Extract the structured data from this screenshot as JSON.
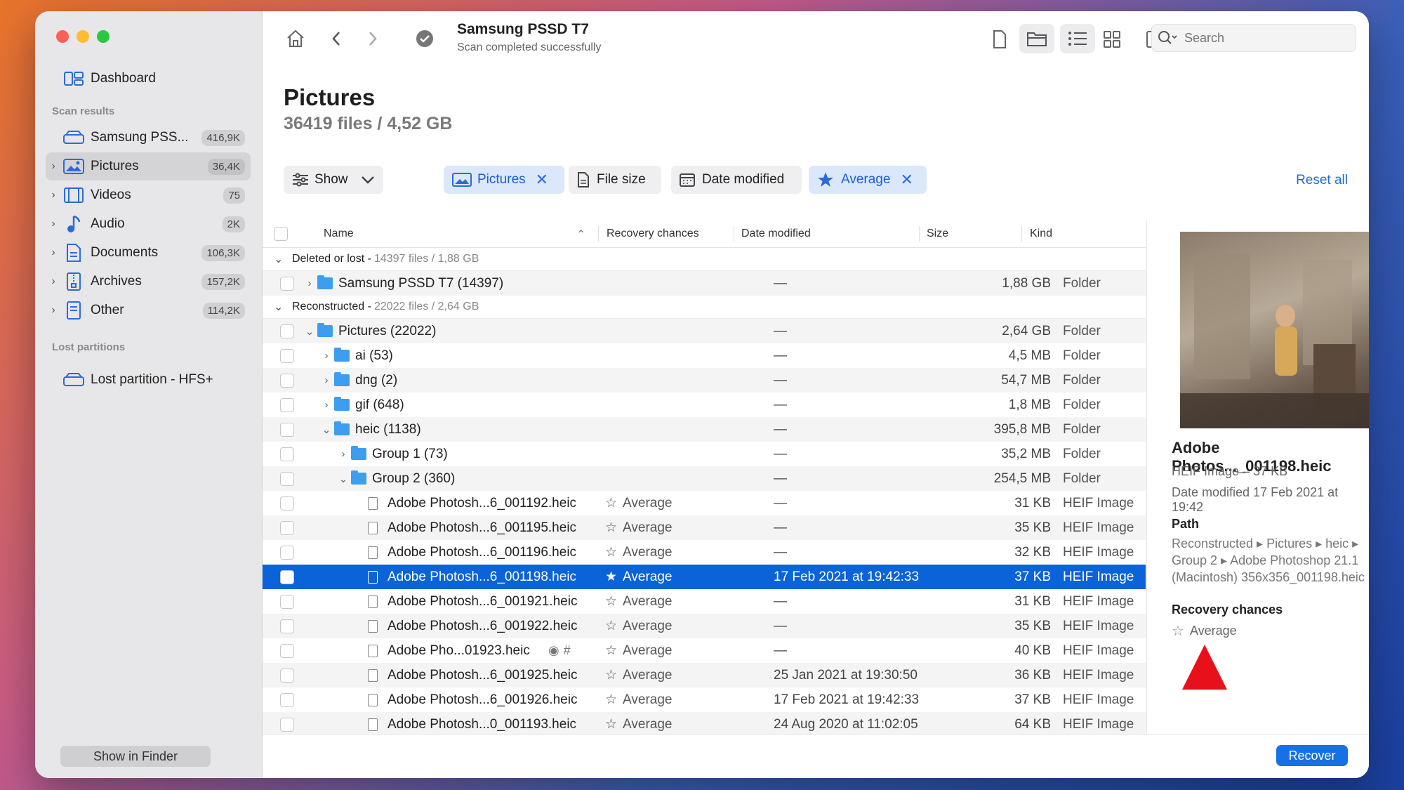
{
  "sidebar": {
    "dashboard": "Dashboard",
    "scan_results_title": "Scan results",
    "items": [
      {
        "label": "Samsung PSS...",
        "badge": "416,9K"
      },
      {
        "label": "Pictures",
        "badge": "36,4K"
      },
      {
        "label": "Videos",
        "badge": "75"
      },
      {
        "label": "Audio",
        "badge": "2K"
      },
      {
        "label": "Documents",
        "badge": "106,3K"
      },
      {
        "label": "Archives",
        "badge": "157,2K"
      },
      {
        "label": "Other",
        "badge": "114,2K"
      }
    ],
    "lost_partitions_title": "Lost partitions",
    "lost_partition": "Lost partition - HFS+",
    "show_in_finder": "Show in Finder"
  },
  "toolbar": {
    "title": "Samsung PSSD T7",
    "subtitle": "Scan completed successfully",
    "search_placeholder": "Search"
  },
  "page": {
    "title": "Pictures",
    "summary": "36419 files / 4,52 GB"
  },
  "filters": {
    "show": "Show",
    "pictures": "Pictures",
    "file_size": "File size",
    "date_modified": "Date modified",
    "average": "Average",
    "reset_all": "Reset all"
  },
  "table": {
    "headers": {
      "name": "Name",
      "recovery": "Recovery chances",
      "date": "Date modified",
      "size": "Size",
      "kind": "Kind"
    },
    "group1": {
      "label": "Deleted or lost -",
      "count": "14397 files / 1,88 GB"
    },
    "group2": {
      "label": "Reconstructed -",
      "count": "22022 files / 2,64 GB"
    },
    "rows": [
      {
        "name": "Samsung PSSD T7 (14397)",
        "rec": "",
        "date": "—",
        "size": "1,88 GB",
        "kind": "Folder"
      },
      {
        "name": "Pictures (22022)",
        "rec": "",
        "date": "—",
        "size": "2,64 GB",
        "kind": "Folder"
      },
      {
        "name": "ai (53)",
        "rec": "",
        "date": "—",
        "size": "4,5 MB",
        "kind": "Folder"
      },
      {
        "name": "dng (2)",
        "rec": "",
        "date": "—",
        "size": "54,7 MB",
        "kind": "Folder"
      },
      {
        "name": "gif (648)",
        "rec": "",
        "date": "—",
        "size": "1,8 MB",
        "kind": "Folder"
      },
      {
        "name": "heic (1138)",
        "rec": "",
        "date": "—",
        "size": "395,8 MB",
        "kind": "Folder"
      },
      {
        "name": "Group 1 (73)",
        "rec": "",
        "date": "—",
        "size": "35,2 MB",
        "kind": "Folder"
      },
      {
        "name": "Group 2 (360)",
        "rec": "",
        "date": "—",
        "size": "254,5 MB",
        "kind": "Folder"
      },
      {
        "name": "Adobe Photosh...6_001192.heic",
        "rec": "Average",
        "date": "—",
        "size": "31 KB",
        "kind": "HEIF Image"
      },
      {
        "name": "Adobe Photosh...6_001195.heic",
        "rec": "Average",
        "date": "—",
        "size": "35 KB",
        "kind": "HEIF Image"
      },
      {
        "name": "Adobe Photosh...6_001196.heic",
        "rec": "Average",
        "date": "—",
        "size": "32 KB",
        "kind": "HEIF Image"
      },
      {
        "name": "Adobe Photosh...6_001198.heic",
        "rec": "Average",
        "date": "17 Feb 2021 at 19:42:33",
        "size": "37 KB",
        "kind": "HEIF Image"
      },
      {
        "name": "Adobe Photosh...6_001921.heic",
        "rec": "Average",
        "date": "—",
        "size": "31 KB",
        "kind": "HEIF Image"
      },
      {
        "name": "Adobe Photosh...6_001922.heic",
        "rec": "Average",
        "date": "—",
        "size": "35 KB",
        "kind": "HEIF Image"
      },
      {
        "name": "Adobe Pho...01923.heic",
        "rec": "Average",
        "date": "—",
        "size": "40 KB",
        "kind": "HEIF Image"
      },
      {
        "name": "Adobe Photosh...6_001925.heic",
        "rec": "Average",
        "date": "25 Jan 2021 at 19:30:50",
        "size": "36 KB",
        "kind": "HEIF Image"
      },
      {
        "name": "Adobe Photosh...6_001926.heic",
        "rec": "Average",
        "date": "17 Feb 2021 at 19:42:33",
        "size": "37 KB",
        "kind": "HEIF Image"
      },
      {
        "name": "Adobe Photosh...0_001193.heic",
        "rec": "Average",
        "date": "24 Aug 2020 at 11:02:05",
        "size": "64 KB",
        "kind": "HEIF Image"
      }
    ]
  },
  "preview": {
    "title": "Adobe Photos..._001198.heic",
    "type": "HEIF Image – 37 KB",
    "date": "Date modified 17 Feb 2021 at 19:42",
    "path_title": "Path",
    "path": "Reconstructed ▸ Pictures ▸ heic ▸ Group 2 ▸ Adobe Photoshop 21.1 (Macintosh) 356x356_001198.heic",
    "recovery_title": "Recovery chances",
    "recovery": "Average"
  },
  "recover_button": "Recover",
  "colors": {
    "accent": "#0a63d8",
    "annotation_arrow": "#e8101a"
  }
}
